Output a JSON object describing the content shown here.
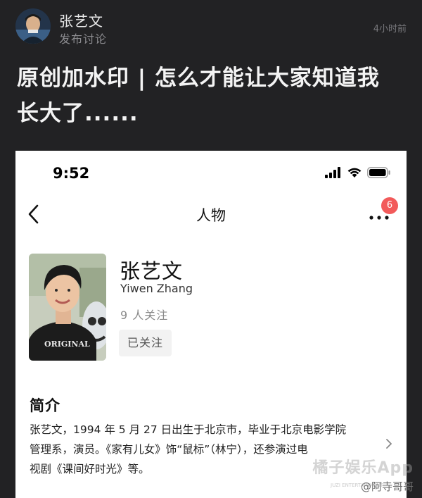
{
  "post": {
    "author_name": "张艺文",
    "author_action": "发布讨论",
    "time": "4小时前",
    "title_line1": "原创加水印 | 怎么才能让大家知道我",
    "title_line2": "长大了......"
  },
  "screenshot": {
    "status_time": "9:52",
    "nav_title": "人物",
    "nav_badge": "6",
    "profile": {
      "name": "张艺文",
      "english_name": "Yiwen Zhang",
      "followers": "9 人关注",
      "follow_button": "已关注",
      "shirt_text": "ORIGINAL"
    },
    "intro": {
      "heading": "简介",
      "line1": "张艺文，1994 年 5 月 27 日出生于北京市，毕业于北京电影学院",
      "line2": "管理系，演员。《家有儿女》饰“鼠标”（林宁），还参演过电",
      "line3": "视剧《课间好时光》等。"
    }
  },
  "watermark": {
    "brand": "橘子娱乐App",
    "sub": "JUZI ENTERTAINMENT",
    "credit": "@阿寺哥哥"
  }
}
